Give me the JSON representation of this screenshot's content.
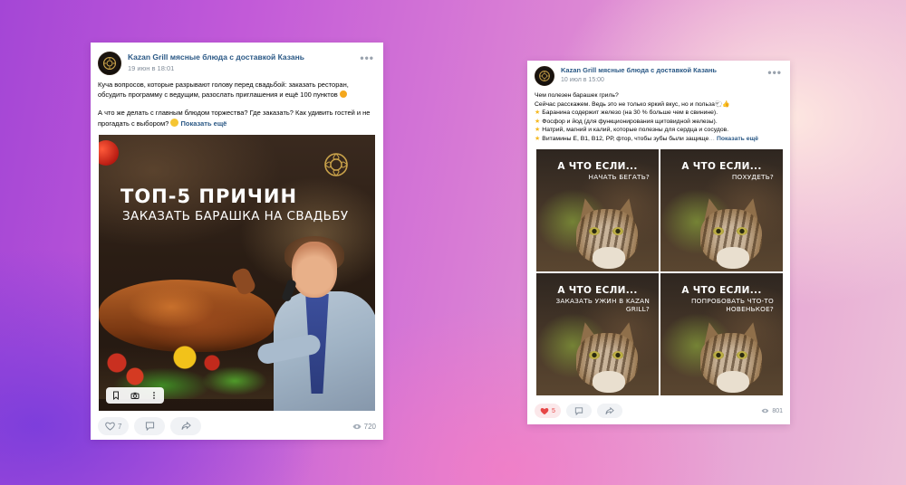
{
  "posts": [
    {
      "author": "Kazan Grill мясные блюда с доставкой Казань",
      "date": "19 июн в 18:01",
      "text": {
        "p1": "Куча вопросов, которые разрывают голову перед свадьбой: заказать ресторан, обсудить программу с ведущим, разослать приглашения и ещё 100 пунктов",
        "p2": "А что же делать с главным блюдом торжества? Где заказать? Как удивить гостей и не прогадать с выбором?",
        "show_more": "Показать ещё"
      },
      "photo": {
        "headline1": "ТОП-5 ПРИЧИН",
        "headline2": "ЗАКАЗАТЬ БАРАШКА НА СВАДЬБУ",
        "actions": [
          "bookmark-icon",
          "camera-icon",
          "more-vertical-icon"
        ]
      },
      "likes": "7",
      "views": "720",
      "liked": false
    },
    {
      "author": "Kazan Grill мясные блюда с доставкой Казань",
      "date": "10 июл в 15:00",
      "text": {
        "l1": "Чем полезен барашек гриль?",
        "l2": "Сейчас расскажем. Ведь это не только яркий вкус, но и польза",
        "l3": "Баранина содержит железо (на 30 % больше чем в свинине).",
        "l4": "Фосфор и йод (для функционирования щитовидной железы).",
        "l5": "Натрий, магний и калий, которые полезны для сердца и сосудов.",
        "l6": "Витамины Е, В1, В12, РР, фтор, чтобы зубы были защище",
        "show_more": "Показать ещё"
      },
      "tiles": [
        {
          "title": "А ЧТО ЕСЛИ...",
          "subtitle": "НАЧАТЬ БЕГАТЬ?"
        },
        {
          "title": "А ЧТО ЕСЛИ...",
          "subtitle": "ПОХУДЕТЬ?"
        },
        {
          "title": "А ЧТО ЕСЛИ...",
          "subtitle": "ЗАКАЗАТЬ УЖИН В KAZAN GRILL?"
        },
        {
          "title": "А ЧТО ЕСЛИ...",
          "subtitle": "ПОПРОБОВАТЬ ЧТО-ТО НОВЕНЬКОЕ?"
        }
      ],
      "likes": "5",
      "views": "801",
      "liked": true
    }
  ],
  "colors": {
    "link": "#2a5885",
    "meta": "#818c99",
    "like_active": "#e64646",
    "pill_bg": "#f0f2f5",
    "logo_gold": "#c9a24a"
  }
}
